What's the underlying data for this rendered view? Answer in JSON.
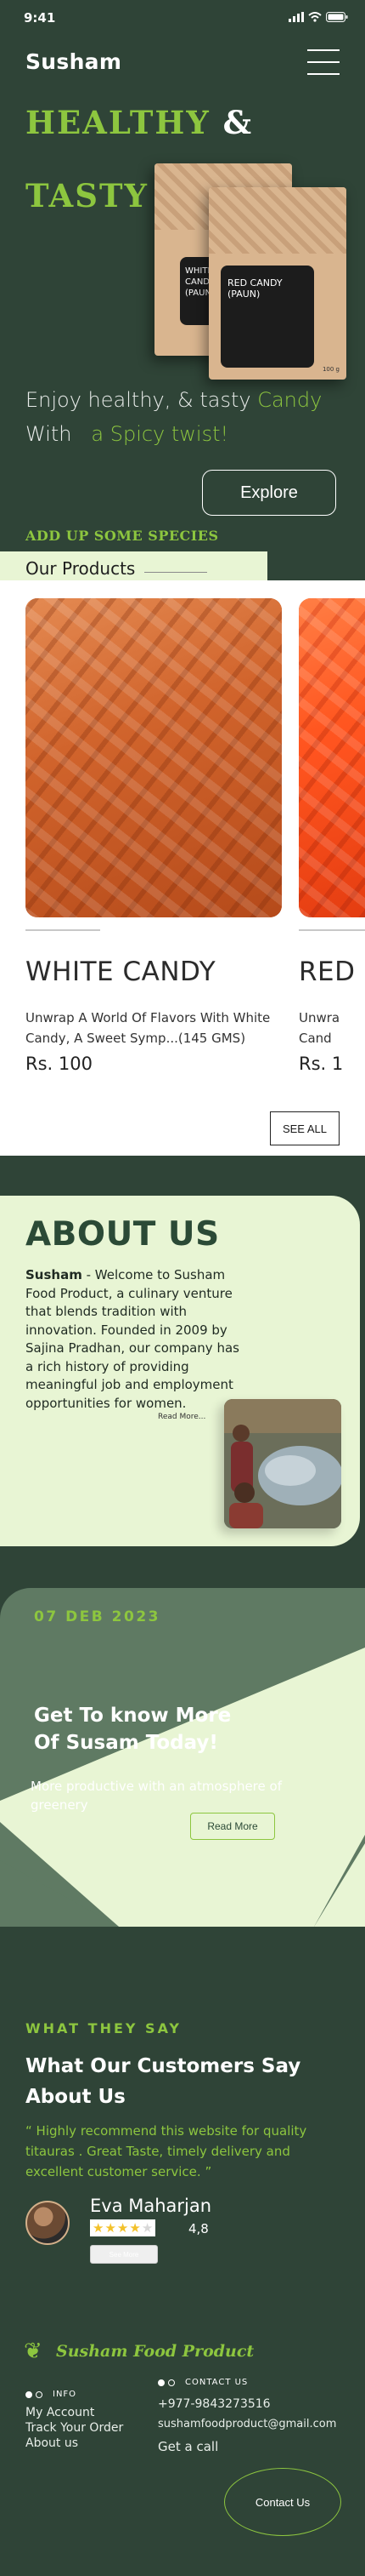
{
  "status": {
    "time": "9:41"
  },
  "header": {
    "brand": "Susham"
  },
  "hero": {
    "title_line1": "HEALTHY",
    "amp": "&",
    "title_line2": "TASTY",
    "package_text": "RED CANDY (PAUN)",
    "package_back_text": "WHITE CANDY (PAUN)",
    "package_weight": "100 g",
    "tagline_part1": "Enjoy healthy, & tasty",
    "tagline_candy": "Candy",
    "tagline_with": "With",
    "tagline_part2": "a Spicy twist!",
    "explore_label": "Explore",
    "species_label": "ADD UP SOME SPECIES"
  },
  "products": {
    "section_label": "Our Products",
    "items": [
      {
        "name": "WHITE CANDY",
        "desc_line1": "Unwrap A World Of Flavors With White",
        "desc_line2": "Candy, A Sweet Symp...(145 GMS)",
        "price": "Rs. 100"
      },
      {
        "name": "RED",
        "desc_line1": "Unwra",
        "desc_line2": "Cand",
        "price": "Rs. 1"
      }
    ],
    "see_all_label": "SEE ALL"
  },
  "about": {
    "title": "ABOUT US",
    "brand_bold": "Susham",
    "text": " - Welcome to Susham Food Product, a culinary venture that blends tradition with innovation. Founded in 2009 by Sajina Pradhan, our company has a rich history of providing meaningful job and employment opportunities for women.",
    "read_more": "Read More..."
  },
  "promo": {
    "date": "07 DEB 2023",
    "title_line1": "Get To know More",
    "title_line2": "Of Susam Today!",
    "text": "More productive with an atmosphere of greenery",
    "button_label": "Read More"
  },
  "testimonials": {
    "kicker": "WHAT THEY SAY",
    "title_line1": "What Our Customers Say",
    "title_line2": "About Us",
    "quote": "“ Highly recommend this website for quality titauras . Great Taste, timely delivery and excellent customer service. ”",
    "reviewer": "Eva Maharjan",
    "rating": "4,8",
    "stars_filled": 4,
    "see_more": "See More"
  },
  "footer": {
    "logo_text": "Susham Food Product",
    "info_heading": "INFO",
    "info_links": [
      "My Account",
      "Track Your Order",
      "About us"
    ],
    "contact_heading": "CONTACT US",
    "phone": "+977-9843273516",
    "email": "sushamfoodproduct@gmail.com",
    "get_call": "Get a call",
    "contact_button": "Contact Us"
  },
  "colors": {
    "bg": "#2f4437",
    "accent": "#8dc63f",
    "mint": "#e8f5d4",
    "promo": "#5f7a63"
  }
}
